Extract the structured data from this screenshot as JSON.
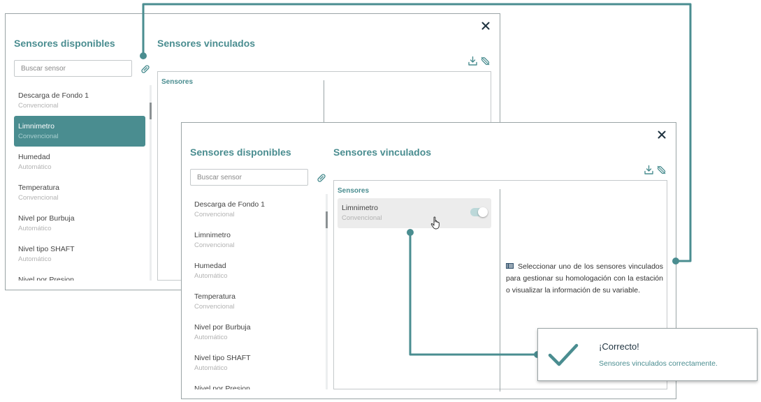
{
  "colors": {
    "accent": "#4a8d90",
    "border": "#9aa4a6",
    "muted": "#b3b3b3"
  },
  "icons": {
    "close": "close-icon",
    "clip": "paperclip-icon",
    "download": "download-icon",
    "unlink": "unlink-icon",
    "info": "list-icon",
    "check": "check-icon",
    "cursor": "hand-pointer-icon"
  },
  "dialog_back": {
    "available_title": "Sensores disponibles",
    "linked_title": "Sensores vinculados",
    "search_placeholder": "Buscar sensor",
    "sensors_label": "Sensores",
    "items": [
      {
        "name": "Descarga de Fondo 1",
        "type": "Convencional"
      },
      {
        "name": "Limnimetro",
        "type": "Convencional"
      },
      {
        "name": "Humedad",
        "type": "Automático"
      },
      {
        "name": "Temperatura",
        "type": "Convencional"
      },
      {
        "name": "Nivel por Burbuja",
        "type": "Automático"
      },
      {
        "name": "Nivel tipo SHAFT",
        "type": "Automático"
      },
      {
        "name": "Nivel por Presion",
        "type": ""
      }
    ]
  },
  "dialog_front": {
    "available_title": "Sensores disponibles",
    "linked_title": "Sensores vinculados",
    "search_placeholder": "Buscar sensor",
    "sensors_label": "Sensores",
    "items": [
      {
        "name": "Descarga de Fondo 1",
        "type": "Convencional"
      },
      {
        "name": "Limnimetro",
        "type": "Convencional"
      },
      {
        "name": "Humedad",
        "type": "Automático"
      },
      {
        "name": "Temperatura",
        "type": "Convencional"
      },
      {
        "name": "Nivel por Burbuja",
        "type": "Automático"
      },
      {
        "name": "Nivel tipo SHAFT",
        "type": "Automático"
      },
      {
        "name": "Nivel por Presion",
        "type": ""
      }
    ],
    "linked": {
      "name": "Limnimetro",
      "type": "Convencional",
      "enabled": true
    },
    "info_text": "Seleccionar uno de los sensores vinculados para gestionar su homologación con la estación o visualizar la información de su variable."
  },
  "toast": {
    "title": "¡Correcto!",
    "message": "Sensores vinculados correctamente."
  }
}
